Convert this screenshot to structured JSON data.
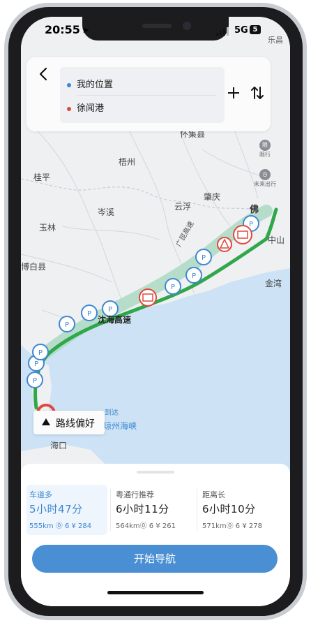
{
  "status_bar": {
    "time": "20:55",
    "network": "5G",
    "battery": "5",
    "corner_label": "乐昌"
  },
  "search": {
    "origin": "我的位置",
    "destination": "徐闻港",
    "origin_color": "#3a86d1",
    "destination_color": "#e0483e"
  },
  "map_controls": {
    "restrict_label": "限行",
    "restrict_icon_text": "限",
    "future_label": "未来出行"
  },
  "map_labels": {
    "huaiji": "怀集县",
    "wuzhou": "梧州",
    "guiping": "桂平",
    "cenxi": "岑溪",
    "yunfu": "云浮",
    "zhaoqing": "肇庆",
    "yulin": "玉林",
    "foshan": "佛",
    "zhongshan": "中山",
    "bobai": "博白县",
    "jinwan": "金湾",
    "highway_name": "沈海高速",
    "expressway_vertical": "广昆高速",
    "strait": "琼州海峡",
    "haikou": "海口",
    "arrival_fragment": "到达"
  },
  "route_preference": {
    "label": "路线偏好"
  },
  "routes": [
    {
      "tag": "车道多",
      "time": "5小时47分",
      "info": "555km ⓪ 6 ¥ 284",
      "selected": true
    },
    {
      "tag": "粤通行推荐",
      "time": "6小时11分",
      "info": "564km⓪ 6 ¥ 261",
      "selected": false
    },
    {
      "tag": "距离长",
      "time": "6小时10分",
      "info": "571km⓪ 6 ¥ 278",
      "selected": false
    }
  ],
  "start_button": {
    "label": "开始导航"
  },
  "colors": {
    "accent": "#4a8fd4",
    "route_main": "#2fa74a",
    "route_alt": "#9fd3b7",
    "poi_blue": "#3f86d4",
    "camera_red": "#e0483e",
    "sea": "#cde3f5"
  }
}
